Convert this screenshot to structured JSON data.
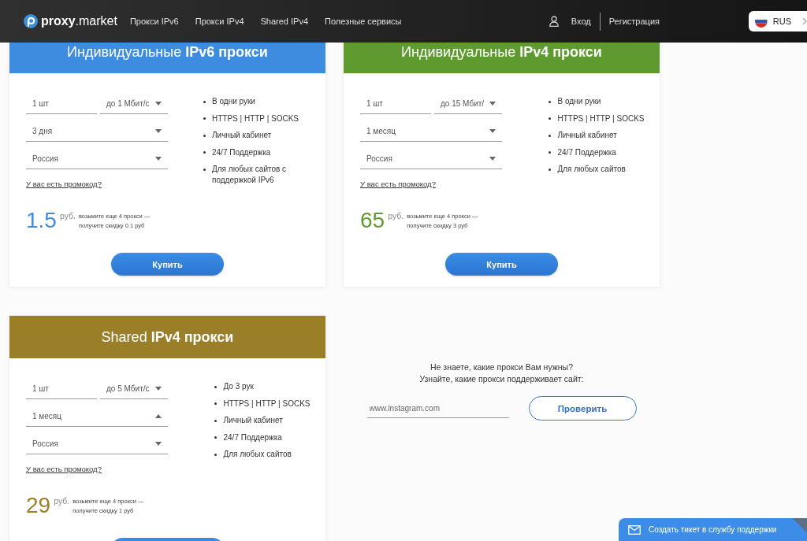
{
  "header": {
    "logo": "**proxy**.market",
    "nav": [
      {
        "label": "Прокси IPv6"
      },
      {
        "label": "Прокси IPv4"
      },
      {
        "label": "Shared IPv4"
      },
      {
        "label": "Полезные сервисы"
      }
    ],
    "login": "Вход",
    "register": "Регистрация",
    "language": "RUS"
  },
  "cards": [
    {
      "title": "Индивидуальные **IPv6 прокси**",
      "color": "#3d8ce0",
      "quantity": {
        "value": "1 шт"
      },
      "speed": {
        "value": "до 1 Мбит/с",
        "expanded": false
      },
      "period": {
        "value": "3 дня",
        "expanded": false
      },
      "country": {
        "value": "Россия",
        "expanded": false
      },
      "promo": "У вас есть промокод?",
      "features": [
        "В одни руки",
        "HTTPS | HTTP | SOCKS",
        "Личный кабинет",
        "24/7 Поддержка",
        "Для любых сайтов с поддержкой IPv6"
      ],
      "price": "1.5",
      "currency": "руб.",
      "discount": "возьмите еще 4 прокси —\nполучите скидку 0.1 руб",
      "buy": "Купить"
    },
    {
      "title": "Индивидуальные **IPv4 прокси**",
      "color": "#5e9a2f",
      "quantity": {
        "value": "1 шт"
      },
      "speed": {
        "value": "до 15 Мбит/",
        "expanded": false
      },
      "period": {
        "value": "1 месяц",
        "expanded": false
      },
      "country": {
        "value": "Россия",
        "expanded": false
      },
      "promo": "У вас есть промокод?",
      "features": [
        "В одни руки",
        "HTTPS | HTTP | SOCKS",
        "Личный кабинет",
        "24/7 Поддержка",
        "Для любых сайтов"
      ],
      "price": "65",
      "currency": "руб.",
      "discount": "возьмите еще 4 прокси —\nполучите скидку 3 руб",
      "buy": "Купить"
    },
    {
      "title": "Shared **IPv4 прокси**",
      "color": "#9b7f28",
      "quantity": {
        "value": "1 шт"
      },
      "speed": {
        "value": "до 5 Мбит/с",
        "expanded": false
      },
      "period": {
        "value": "1 месяц",
        "expanded": true
      },
      "country": {
        "value": "Россия",
        "expanded": false
      },
      "promo": "У вас есть промокод?",
      "features": [
        "До 3 рук",
        "HTTPS | HTTP | SOCKS",
        "Личный кабинет",
        "24/7 Поддержка",
        "Для любых сайтов"
      ],
      "price": "29",
      "currency": "руб.",
      "discount": "возьмите еще 4 прокси —\nполучите скидку 1 руб"
    }
  ],
  "site_check": {
    "lines": [
      "Не знаете, какие прокси Вам нужны?",
      "Узнайте, какие прокси поддерживает сайт:"
    ],
    "input": {
      "placeholder": "www.instagram.com"
    },
    "button": "Проверить"
  },
  "support": {
    "label": "Создать тикет в службу поддержки"
  }
}
